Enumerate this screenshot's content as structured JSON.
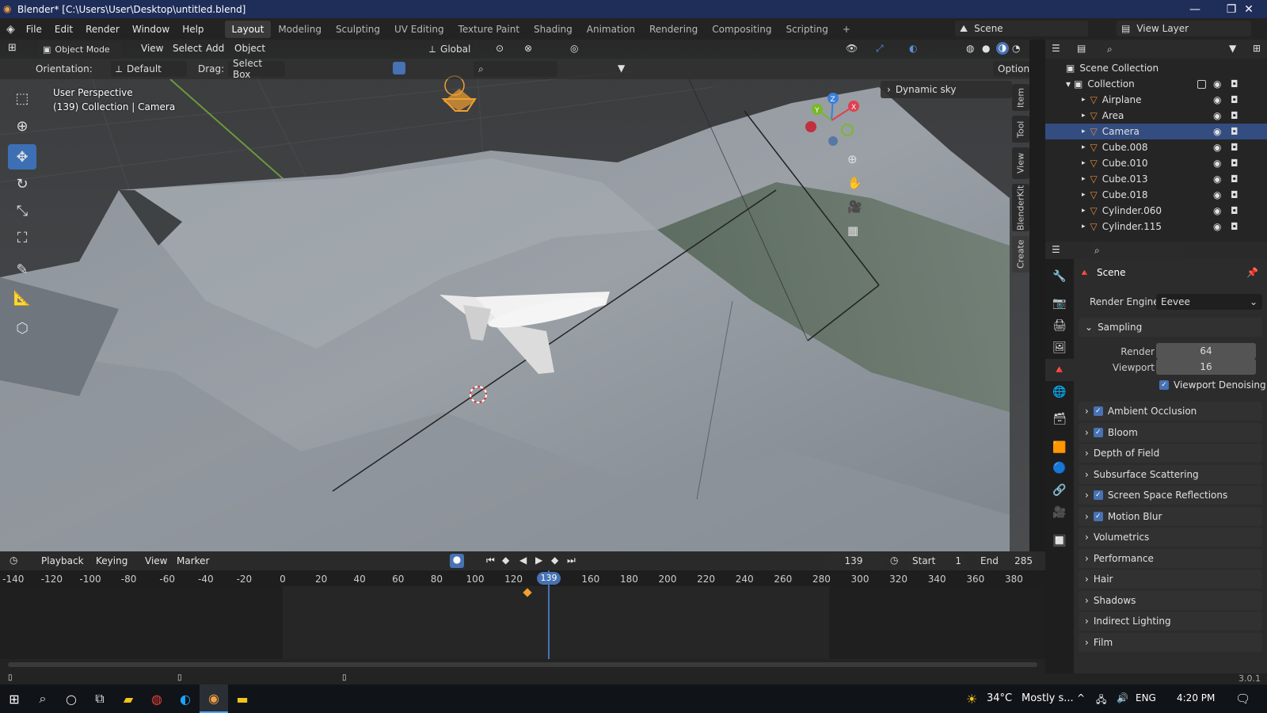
{
  "window": {
    "title": "Blender* [C:\\Users\\User\\Desktop\\untitled.blend]",
    "min": "—",
    "max": "❐",
    "close": "✕"
  },
  "menu": {
    "items": [
      "File",
      "Edit",
      "Render",
      "Window",
      "Help"
    ]
  },
  "workspaces": [
    "Layout",
    "Modeling",
    "Sculpting",
    "UV Editing",
    "Texture Paint",
    "Shading",
    "Animation",
    "Rendering",
    "Compositing",
    "Scripting",
    "+"
  ],
  "scene": {
    "name": "Scene",
    "view_layer": "View Layer"
  },
  "viewport_header": {
    "mode": "Object Mode",
    "view": "View",
    "select": "Select",
    "add": "Add",
    "object": "Object",
    "transform": "Global",
    "orientation_label": "Orientation:",
    "orientation": "Default",
    "drag_label": "Drag:",
    "drag": "Select Box",
    "options": "Options"
  },
  "viewport_overlay": {
    "perspective": "User Perspective",
    "context": "(139) Collection | Camera",
    "sky_panel": "Dynamic sky"
  },
  "sidebar_tabs": [
    "Item",
    "Tool",
    "View",
    "BlenderKit",
    "Create"
  ],
  "timeline": {
    "menus": [
      "Playback",
      "Keying",
      "View",
      "Marker"
    ],
    "current_frame": "139",
    "start_label": "Start",
    "start": "1",
    "end_label": "End",
    "end": "285",
    "ticks": [
      "-140",
      "-120",
      "-100",
      "-80",
      "-60",
      "-40",
      "-20",
      "0",
      "20",
      "40",
      "60",
      "80",
      "100",
      "120",
      "139",
      "160",
      "180",
      "200",
      "220",
      "240",
      "260",
      "280",
      "300",
      "320",
      "340",
      "360",
      "380"
    ]
  },
  "outliner": {
    "root": "Scene Collection",
    "collection": "Collection",
    "items": [
      {
        "name": "Airplane",
        "icon": "mesh-icon",
        "selected": false
      },
      {
        "name": "Area",
        "icon": "light-icon",
        "selected": false
      },
      {
        "name": "Camera",
        "icon": "camera-icon",
        "selected": true
      },
      {
        "name": "Cube.008",
        "icon": "mesh-icon",
        "selected": false
      },
      {
        "name": "Cube.010",
        "icon": "mesh-icon",
        "selected": false
      },
      {
        "name": "Cube.013",
        "icon": "mesh-icon",
        "selected": false
      },
      {
        "name": "Cube.018",
        "icon": "mesh-icon",
        "selected": false
      },
      {
        "name": "Cylinder.060",
        "icon": "mesh-icon",
        "selected": false
      },
      {
        "name": "Cylinder.115",
        "icon": "mesh-icon",
        "selected": false
      }
    ]
  },
  "properties": {
    "title": "Scene",
    "render_engine_label": "Render Engine",
    "render_engine": "Eevee",
    "sampling": "Sampling",
    "render_label": "Render",
    "render_value": "64",
    "viewport_label": "Viewport",
    "viewport_value": "16",
    "denoise": "Viewport Denoising",
    "panels": [
      {
        "label": "Ambient Occlusion",
        "checkbox": true
      },
      {
        "label": "Bloom",
        "checkbox": true
      },
      {
        "label": "Depth of Field",
        "checkbox": false
      },
      {
        "label": "Subsurface Scattering",
        "checkbox": false
      },
      {
        "label": "Screen Space Reflections",
        "checkbox": true
      },
      {
        "label": "Motion Blur",
        "checkbox": true
      },
      {
        "label": "Volumetrics",
        "checkbox": false
      },
      {
        "label": "Performance",
        "checkbox": false
      },
      {
        "label": "Hair",
        "checkbox": false
      },
      {
        "label": "Shadows",
        "checkbox": false
      },
      {
        "label": "Indirect Lighting",
        "checkbox": false
      },
      {
        "label": "Film",
        "checkbox": false
      }
    ]
  },
  "statusbar": {
    "version": "3.0.1"
  },
  "taskbar": {
    "weather_temp": "34°C",
    "weather_text": "Mostly s...",
    "lang": "ENG",
    "time": "4:20 PM"
  },
  "colors": {
    "accent": "#4772b3",
    "selected_row": "#334d80",
    "title_bar": "#1f2d59",
    "mesh_icon": "#e0883a"
  }
}
